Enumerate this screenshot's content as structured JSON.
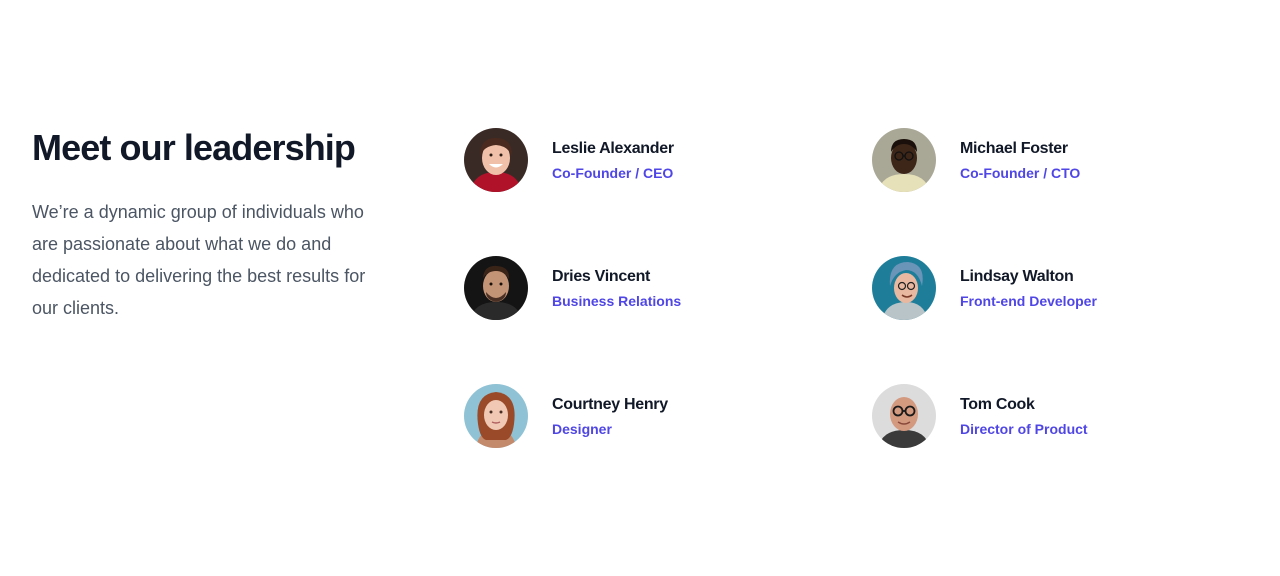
{
  "header": {
    "title": "Meet our leadership",
    "description": "We’re a dynamic group of individuals who are passionate about what we do and dedicated to delivering the best results for our clients."
  },
  "colors": {
    "heading": "#111827",
    "body": "#4b5563",
    "accent": "#4f46e5"
  },
  "people": [
    {
      "name": "Leslie Alexander",
      "role": "Co-Founder / CEO",
      "avatar": "leslie-alexander-photo"
    },
    {
      "name": "Michael Foster",
      "role": "Co-Founder / CTO",
      "avatar": "michael-foster-photo"
    },
    {
      "name": "Dries Vincent",
      "role": "Business Relations",
      "avatar": "dries-vincent-photo"
    },
    {
      "name": "Lindsay Walton",
      "role": "Front-end Developer",
      "avatar": "lindsay-walton-photo"
    },
    {
      "name": "Courtney Henry",
      "role": "Designer",
      "avatar": "courtney-henry-photo"
    },
    {
      "name": "Tom Cook",
      "role": "Director of Product",
      "avatar": "tom-cook-photo"
    }
  ]
}
